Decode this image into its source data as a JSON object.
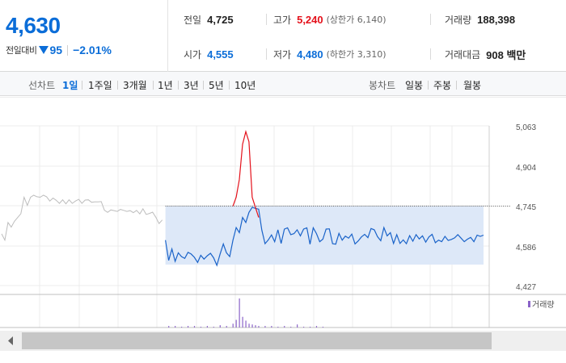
{
  "quote": {
    "price": "4,630",
    "change_label": "전일대비",
    "change_icon": "down-triangle-icon",
    "change_amount": "95",
    "change_percent": "−2.01%",
    "stats": {
      "prev_close": {
        "label": "전일",
        "value": "4,725"
      },
      "high": {
        "label": "고가",
        "value": "5,240",
        "sub": "(상한가 6,140)"
      },
      "volume": {
        "label": "거래량",
        "value": "188,398"
      },
      "open": {
        "label": "시가",
        "value": "4,555"
      },
      "low": {
        "label": "저가",
        "value": "4,480",
        "sub": "(하한가 3,310)"
      },
      "amount": {
        "label": "거래대금",
        "value": "908 백만"
      }
    },
    "colors": {
      "up": "#e4111b",
      "down": "#0b6dd8"
    }
  },
  "period": {
    "line_label": "선차트",
    "line_options": [
      "1일",
      "1주일",
      "3개월",
      "1년",
      "3년",
      "5년",
      "10년"
    ],
    "line_selected": "1일",
    "candle_label": "봉차트",
    "candle_options": [
      "일봉",
      "주봉",
      "월봉"
    ]
  },
  "chart_data": {
    "type": "line",
    "y_ticks": [
      "5,063",
      "4,904",
      "4,745",
      "4,586",
      "4,427"
    ],
    "ylim": [
      4427,
      5063
    ],
    "prev_close": 4745,
    "volume_legend": "거래량",
    "series": [
      {
        "x": [
          0,
          1,
          2,
          3,
          4,
          5,
          6,
          7,
          8,
          9,
          10,
          11,
          12,
          13,
          14,
          15,
          16,
          17,
          18,
          19,
          20,
          21,
          22,
          23,
          24,
          25,
          26,
          27,
          28,
          29,
          30,
          31,
          32,
          33,
          34,
          35,
          36,
          37,
          38,
          39,
          40,
          41,
          42,
          43,
          44,
          45,
          46,
          47,
          48,
          49,
          50
        ],
        "values": [
          4635,
          4610,
          4680,
          4662,
          4685,
          4700,
          4715,
          4780,
          4748,
          4780,
          4788,
          4782,
          4780,
          4788,
          4782,
          4765,
          4777,
          4768,
          4756,
          4770,
          4754,
          4770,
          4756,
          4765,
          4772,
          4756,
          4769,
          4770,
          4760,
          4762,
          4762,
          4763,
          4729,
          4720,
          4730,
          4727,
          4724,
          4732,
          4728,
          4724,
          4727,
          4719,
          4728,
          4714,
          4734,
          4712,
          4716,
          4721,
          4701,
          4676,
          4690
        ]
      },
      {
        "x": [
          51,
          52,
          53,
          54,
          55,
          56,
          57,
          58,
          59,
          60,
          61,
          62,
          63,
          64,
          65,
          66,
          67,
          68,
          69,
          70,
          71,
          72,
          73,
          74,
          75,
          76,
          77,
          78,
          79,
          80,
          81,
          82,
          83,
          84,
          85,
          86,
          87,
          88,
          89,
          90,
          91,
          92,
          93,
          94,
          95,
          96,
          97,
          98,
          99,
          100,
          101,
          102,
          103,
          104,
          105,
          106,
          107,
          108,
          109,
          110,
          111,
          112,
          113,
          114,
          115,
          116,
          117,
          118,
          119,
          120,
          121,
          122,
          123,
          124,
          125,
          126,
          127,
          128,
          129,
          130,
          131,
          132,
          133,
          134,
          135,
          136,
          137,
          138,
          139,
          140,
          141,
          142,
          143,
          144,
          145,
          146,
          147,
          148,
          149,
          150
        ],
        "values": [
          4610,
          4530,
          4575,
          4526,
          4560,
          4545,
          4538,
          4562,
          4555,
          4542,
          4522,
          4550,
          4535,
          4548,
          4558,
          4540,
          4510,
          4555,
          4595,
          4560,
          4545,
          4610,
          4660,
          4640,
          4700,
          4680,
          4720,
          4740,
          4736,
          4733,
          4650,
          4596,
          4611,
          4631,
          4604,
          4651,
          4597,
          4654,
          4659,
          4632,
          4636,
          4651,
          4627,
          4654,
          4659,
          4594,
          4659,
          4636,
          4604,
          4614,
          4654,
          4655,
          4596,
          4594,
          4637,
          4610,
          4626,
          4618,
          4634,
          4595,
          4607,
          4623,
          4633,
          4620,
          4656,
          4651,
          4624,
          4608,
          4660,
          4627,
          4640,
          4597,
          4632,
          4597,
          4611,
          4596,
          4628,
          4606,
          4632,
          4615,
          4627,
          4602,
          4623,
          4633,
          4600,
          4610,
          4604,
          4625,
          4609,
          4613,
          4619,
          4632,
          4618,
          4604,
          4614,
          4621,
          4604,
          4630,
          4625,
          4630
        ]
      },
      {
        "x": [
          72,
          73,
          74,
          75,
          76,
          77,
          78,
          79,
          80
        ],
        "values": [
          4745,
          4780,
          4850,
          4990,
          5040,
          5000,
          4780,
          4740,
          4700
        ]
      }
    ],
    "volume": {
      "x": [
        52,
        54,
        56,
        58,
        60,
        62,
        64,
        66,
        68,
        70,
        72,
        73,
        74,
        75,
        76,
        77,
        78,
        79,
        80,
        82,
        84,
        86,
        88,
        90,
        92,
        94,
        96,
        98,
        100
      ],
      "values": [
        2,
        2,
        1,
        2,
        2,
        1,
        2,
        1,
        3,
        2,
        5,
        10,
        38,
        14,
        9,
        5,
        4,
        3,
        2,
        2,
        2,
        1,
        2,
        1,
        4,
        1,
        1,
        2,
        1
      ]
    }
  }
}
